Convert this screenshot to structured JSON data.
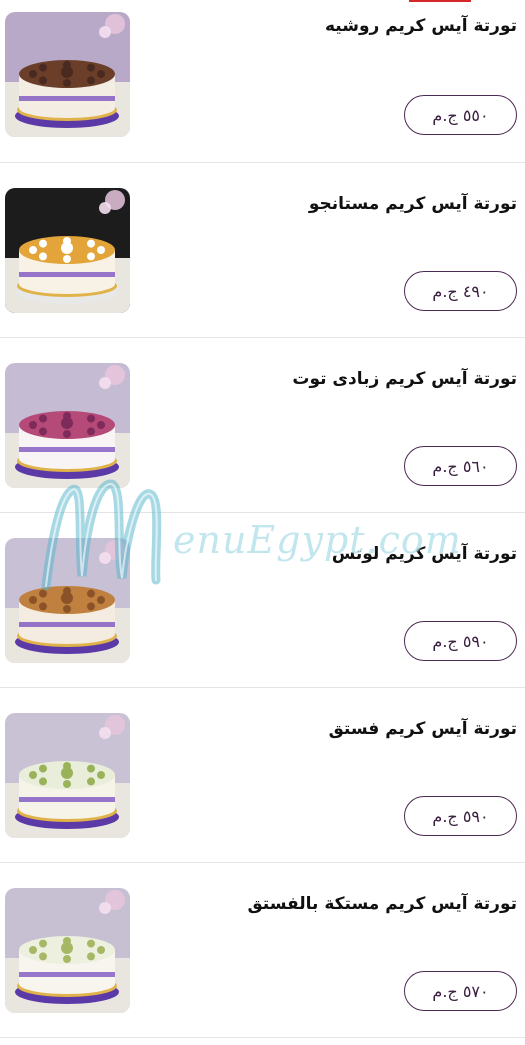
{
  "items": [
    {
      "title": "تورتة آيس كريم روشيه",
      "price": "٥٥٠ ج.م",
      "image": {
        "cake": "#f3ede4",
        "top": "#6b3e2a",
        "deco": "#4a2a20",
        "plate": "#5b3aa8",
        "bg": "#b9a9c9"
      }
    },
    {
      "title": "تورتة آيس كريم مستانجو",
      "price": "٤٩٠ ج.م",
      "image": {
        "cake": "#f7f1e6",
        "top": "#e3a53a",
        "deco": "#ffffff",
        "plate": "#e8e8e8",
        "bg": "#1c1c1c"
      }
    },
    {
      "title": "تورتة آيس كريم زبادى توت",
      "price": "٥٦٠ ج.م",
      "image": {
        "cake": "#f8f4f6",
        "top": "#b54a78",
        "deco": "#7e2a5a",
        "plate": "#5b3aa8",
        "bg": "#c5bcd3"
      }
    },
    {
      "title": "تورتة آيس كريم لوتس",
      "price": "٥٩٠ ج.م",
      "image": {
        "cake": "#f4ece0",
        "top": "#c0803f",
        "deco": "#8a5226",
        "plate": "#5b3aa8",
        "bg": "#c8c0d4"
      }
    },
    {
      "title": "تورتة آيس كريم فستق",
      "price": "٥٩٠ ج.م",
      "image": {
        "cake": "#f6f3e8",
        "top": "#e9eedb",
        "deco": "#9ab35a",
        "plate": "#5b3aa8",
        "bg": "#c9c2d5"
      }
    },
    {
      "title": "تورتة آيس كريم مستكة بالفستق",
      "price": "٥٧٠ ج.م",
      "image": {
        "cake": "#f7f5ee",
        "top": "#eef0df",
        "deco": "#a6b865",
        "plate": "#5b3aa8",
        "bg": "#c7c0d3"
      }
    }
  ],
  "watermark": {
    "text": "enuEgypt.com",
    "color": "#4fb4cc"
  }
}
